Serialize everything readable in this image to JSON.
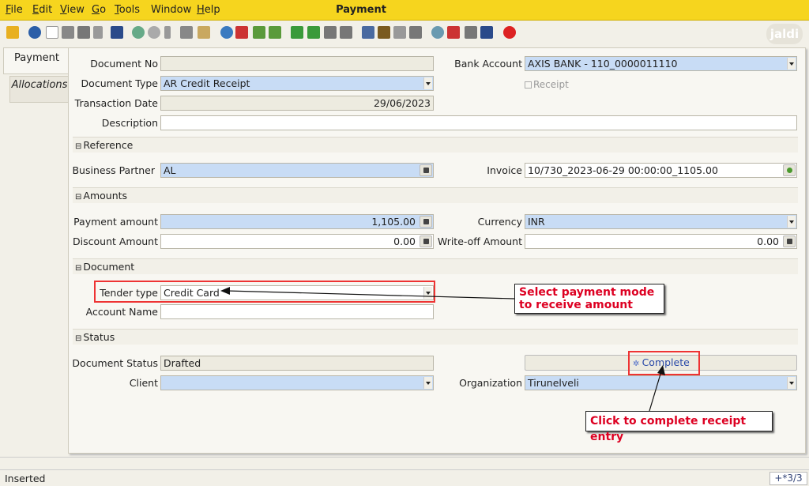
{
  "window": {
    "title": "Payment"
  },
  "menu": [
    {
      "label": "File",
      "key": "F",
      "rest": "ile"
    },
    {
      "label": "Edit",
      "key": "E",
      "rest": "dit"
    },
    {
      "label": "View",
      "key": "V",
      "rest": "iew"
    },
    {
      "label": "Go",
      "key": "G",
      "rest": "o"
    },
    {
      "label": "Tools",
      "key": "T",
      "rest": "ools"
    },
    {
      "label": "Window",
      "key": "",
      "rest": "Window"
    },
    {
      "label": "Help",
      "key": "H",
      "rest": "elp"
    }
  ],
  "toolbar_icons": [
    "undo-icon",
    "help-icon",
    "new-icon",
    "copy-icon",
    "delete-icon",
    "delete-selection-icon",
    "save-icon",
    "refresh-icon",
    "find-icon",
    "attachment-icon",
    "chat-icon",
    "history-icon",
    "home-icon",
    "back-icon",
    "forward-icon",
    "first-record-icon",
    "previous-record-icon",
    "next-record-icon",
    "last-record-icon",
    "report-icon",
    "archive-icon",
    "print-icon",
    "print-preview-icon",
    "zoom-across-icon",
    "workflow-icon",
    "product-info-icon",
    "lock-icon",
    "exit-icon"
  ],
  "logo": "jaldi",
  "tabs": {
    "payment": "Payment",
    "allocations": "Allocations"
  },
  "form": {
    "document_no": {
      "label": "Document No",
      "value": ""
    },
    "document_type": {
      "label": "Document Type",
      "value": "AR Credit Receipt"
    },
    "transaction_date": {
      "label": "Transaction Date",
      "value": "29/06/2023"
    },
    "description": {
      "label": "Description",
      "value": ""
    },
    "bank_account": {
      "label": "Bank Account",
      "value": "AXIS BANK - 110_0000011110"
    },
    "receipt": {
      "label": "Receipt"
    }
  },
  "sections": {
    "reference": "Reference",
    "amounts": "Amounts",
    "document": "Document",
    "status": "Status"
  },
  "reference": {
    "business_partner": {
      "label": "Business Partner",
      "value": "AL"
    },
    "invoice": {
      "label": "Invoice",
      "value": "10/730_2023-06-29 00:00:00_1105.00"
    }
  },
  "amounts": {
    "payment_amount": {
      "label": "Payment amount",
      "value": "1,105.00"
    },
    "currency": {
      "label": "Currency",
      "value": "INR"
    },
    "discount_amount": {
      "label": "Discount Amount",
      "value": "0.00"
    },
    "writeoff_amount": {
      "label": "Write-off Amount",
      "value": "0.00"
    }
  },
  "document": {
    "tender_type": {
      "label": "Tender type",
      "value": "Credit Card"
    },
    "account_name": {
      "label": "Account Name",
      "value": ""
    }
  },
  "status": {
    "document_status": {
      "label": "Document Status",
      "value": "Drafted"
    },
    "complete_button": "Complete",
    "client": {
      "label": "Client",
      "value": ""
    },
    "organization": {
      "label": "Organization",
      "value": "Tirunelveli"
    }
  },
  "annotations": {
    "tender_callout": "Select payment mode to receive amount",
    "complete_callout": "Click to complete receipt entry",
    "highlight_color": "#e33333",
    "callout_text_color": "#d00020"
  },
  "statusbar": {
    "text": "Inserted",
    "count": "+*3/3"
  },
  "colors": {
    "menubar": "#f6d51e",
    "mandatory_field": "#c8dcf5",
    "readonly_field": "#edebe0"
  }
}
